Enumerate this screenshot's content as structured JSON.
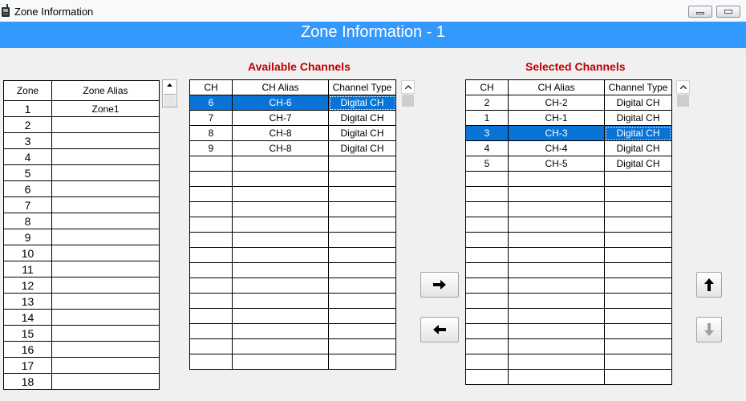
{
  "window": {
    "title": "Zone Information",
    "header": "Zone Information - 1"
  },
  "icons": {
    "app": "walkie-talkie-icon",
    "minimize": "minimize-icon",
    "maximize": "maximize-icon",
    "move_right": "arrow-right-icon",
    "move_left": "arrow-left-icon",
    "move_up": "arrow-up-icon",
    "move_down": "arrow-down-icon"
  },
  "colors": {
    "header_bg": "#3399ff",
    "section_title": "#c00000",
    "selection": "#0a74d6"
  },
  "zone_table": {
    "headers": [
      "Zone",
      "Zone Alias"
    ],
    "rows": [
      {
        "zone": "1",
        "alias": "Zone1"
      },
      {
        "zone": "2",
        "alias": ""
      },
      {
        "zone": "3",
        "alias": ""
      },
      {
        "zone": "4",
        "alias": ""
      },
      {
        "zone": "5",
        "alias": ""
      },
      {
        "zone": "6",
        "alias": ""
      },
      {
        "zone": "7",
        "alias": ""
      },
      {
        "zone": "8",
        "alias": ""
      },
      {
        "zone": "9",
        "alias": ""
      },
      {
        "zone": "10",
        "alias": ""
      },
      {
        "zone": "11",
        "alias": ""
      },
      {
        "zone": "12",
        "alias": ""
      },
      {
        "zone": "13",
        "alias": ""
      },
      {
        "zone": "14",
        "alias": ""
      },
      {
        "zone": "15",
        "alias": ""
      },
      {
        "zone": "16",
        "alias": ""
      },
      {
        "zone": "17",
        "alias": ""
      },
      {
        "zone": "18",
        "alias": ""
      }
    ]
  },
  "available": {
    "title": "Available Channels",
    "headers": [
      "CH",
      "CH Alias",
      "Channel Type"
    ],
    "selected_index": 0,
    "empty_rows": 14,
    "rows": [
      {
        "ch": "6",
        "alias": "CH-6",
        "type": "Digital CH"
      },
      {
        "ch": "7",
        "alias": "CH-7",
        "type": "Digital CH"
      },
      {
        "ch": "8",
        "alias": "CH-8",
        "type": "Digital CH"
      },
      {
        "ch": "9",
        "alias": "CH-8",
        "type": "Digital CH"
      }
    ]
  },
  "selected": {
    "title": "Selected Channels",
    "headers": [
      "CH",
      "CH Alias",
      "Channel Type"
    ],
    "selected_index": 2,
    "empty_rows": 14,
    "rows": [
      {
        "ch": "2",
        "alias": "CH-2",
        "type": "Digital CH"
      },
      {
        "ch": "1",
        "alias": "CH-1",
        "type": "Digital CH"
      },
      {
        "ch": "3",
        "alias": "CH-3",
        "type": "Digital CH"
      },
      {
        "ch": "4",
        "alias": "CH-4",
        "type": "Digital CH"
      },
      {
        "ch": "5",
        "alias": "CH-5",
        "type": "Digital CH"
      }
    ]
  }
}
